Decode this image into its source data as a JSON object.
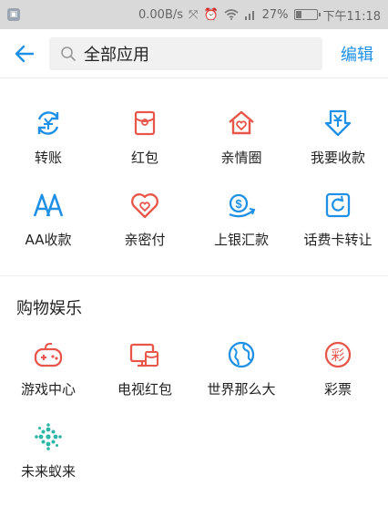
{
  "status_bar": {
    "speed": "0.00B/s",
    "battery": "27%",
    "time": "下午11:18",
    "battery_level": 0.27
  },
  "header": {
    "search_text": "全部应用",
    "edit_label": "编辑"
  },
  "section1": {
    "items": [
      {
        "label": "转账",
        "icon": "transfer-icon"
      },
      {
        "label": "红包",
        "icon": "red-envelope-icon"
      },
      {
        "label": "亲情圈",
        "icon": "family-home-icon"
      },
      {
        "label": "我要收款",
        "icon": "receive-money-icon"
      },
      {
        "label": "AA收款",
        "icon": "aa-icon"
      },
      {
        "label": "亲密付",
        "icon": "intimate-pay-icon"
      },
      {
        "label": "上银汇款",
        "icon": "bank-remit-icon"
      },
      {
        "label": "话费卡转让",
        "icon": "phone-card-icon"
      }
    ]
  },
  "section2": {
    "title": "购物娱乐",
    "items": [
      {
        "label": "游戏中心",
        "icon": "game-controller-icon"
      },
      {
        "label": "电视红包",
        "icon": "tv-envelope-icon"
      },
      {
        "label": "世界那么大",
        "icon": "globe-icon"
      },
      {
        "label": "彩票",
        "icon": "lottery-icon"
      },
      {
        "label": "未来蚁来",
        "icon": "dots-flower-icon"
      }
    ]
  },
  "colors": {
    "accent_blue": "#1e90e6",
    "accent_red": "#e8564a",
    "accent_teal": "#2bb6a8"
  }
}
